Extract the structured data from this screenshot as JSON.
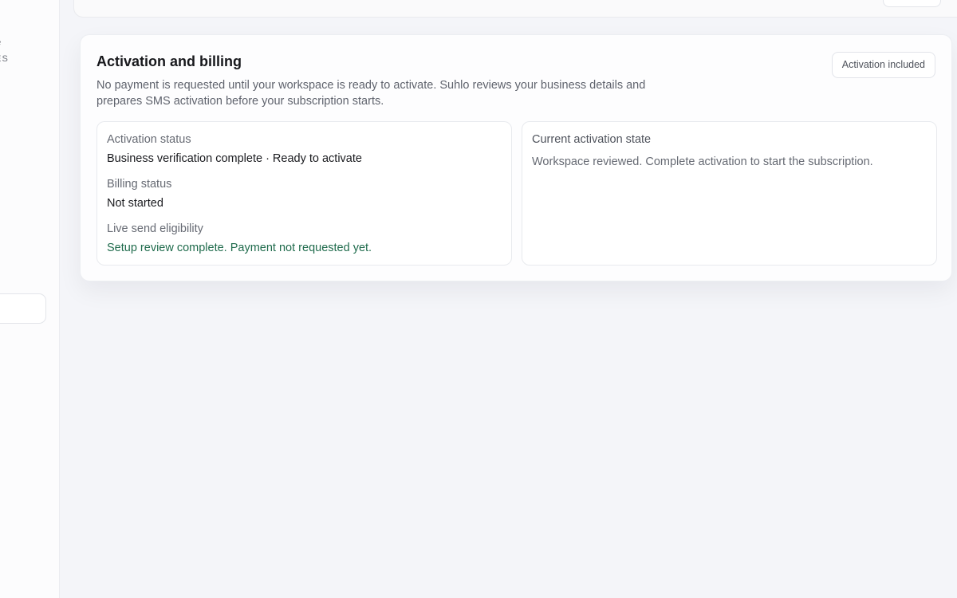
{
  "sidebar": {
    "name_fragment": "e",
    "role_fragment": "ES"
  },
  "billing": {
    "title": "Activation and billing",
    "description": "No payment is requested until your workspace is ready to activate. Suhlo reviews your business details and prepares SMS activation before your subscription starts.",
    "badge": "Activation included",
    "fields": [
      {
        "label": "Activation status",
        "value": "Business verification complete · Ready to activate"
      },
      {
        "label": "Billing status",
        "value": "Not started"
      },
      {
        "label": "Live send eligibility",
        "value": "Setup review complete. Payment not requested yet."
      }
    ],
    "current_state": {
      "label": "Current activation state",
      "text": "Workspace reviewed. Complete activation to start the subscription."
    }
  },
  "colors": {
    "background": "#f4f5f9",
    "success_text": "#1f6b4c"
  }
}
